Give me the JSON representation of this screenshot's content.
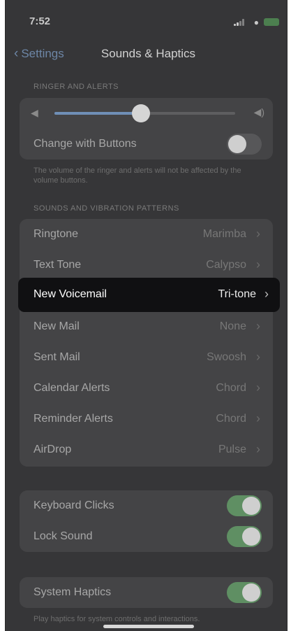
{
  "status_bar": {
    "time": "7:52"
  },
  "nav": {
    "back_label": "Settings",
    "title": "Sounds & Haptics"
  },
  "ringer": {
    "header": "RINGER AND ALERTS",
    "volume_level": 0.48,
    "change_with_buttons": {
      "label": "Change with Buttons",
      "on": false
    },
    "footer": "The volume of the ringer and alerts will not be affected by the volume buttons."
  },
  "sounds": {
    "header": "SOUNDS AND VIBRATION PATTERNS",
    "items": [
      {
        "label": "Ringtone",
        "value": "Marimba"
      },
      {
        "label": "Text Tone",
        "value": "Calypso"
      },
      {
        "label": "New Voicemail",
        "value": "Tri-tone"
      },
      {
        "label": "New Mail",
        "value": "None"
      },
      {
        "label": "Sent Mail",
        "value": "Swoosh"
      },
      {
        "label": "Calendar Alerts",
        "value": "Chord"
      },
      {
        "label": "Reminder Alerts",
        "value": "Chord"
      },
      {
        "label": "AirDrop",
        "value": "Pulse"
      }
    ]
  },
  "feedback": {
    "items": [
      {
        "label": "Keyboard Clicks",
        "on": true
      },
      {
        "label": "Lock Sound",
        "on": true
      }
    ]
  },
  "haptics": {
    "label": "System Haptics",
    "on": true,
    "footer": "Play haptics for system controls and interactions."
  },
  "colors": {
    "toggle_on": "#5f8f63",
    "accent": "#6f8fb7",
    "highlight": "#101012"
  }
}
